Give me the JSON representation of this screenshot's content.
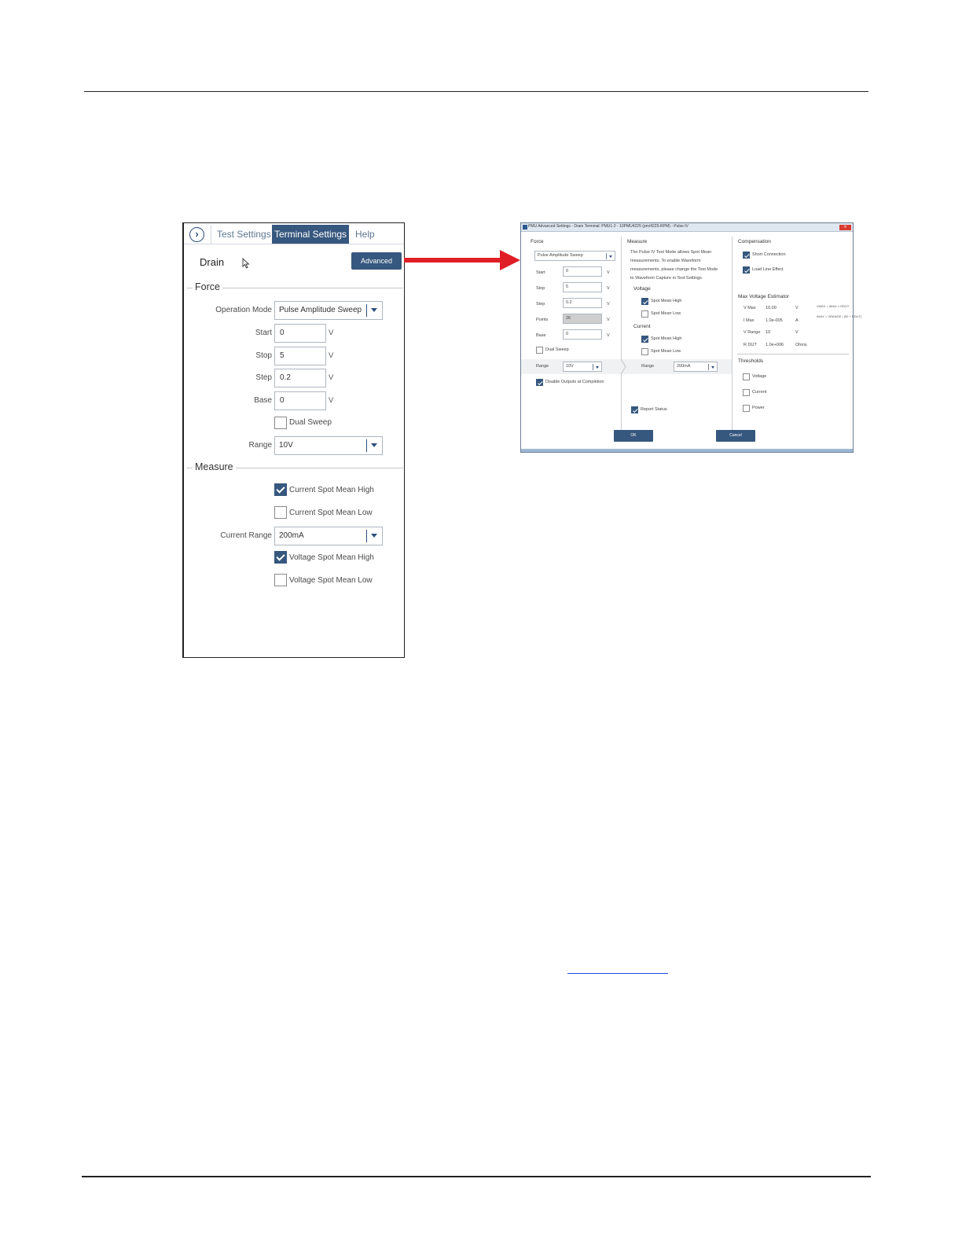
{
  "left_panel": {
    "tabs": [
      "Test Settings",
      "Terminal Settings",
      "Help"
    ],
    "active_tab": "Terminal Settings",
    "terminal_name": "Drain",
    "advanced_button": "Advanced",
    "force": {
      "title": "Force",
      "operation_mode_label": "Operation Mode",
      "operation_mode_value": "Pulse Amplitude Sweep",
      "fields": [
        {
          "label": "Start",
          "value": "0",
          "unit": "V"
        },
        {
          "label": "Stop",
          "value": "5",
          "unit": "V"
        },
        {
          "label": "Step",
          "value": "0.2",
          "unit": "V"
        },
        {
          "label": "Base",
          "value": "0",
          "unit": "V"
        }
      ],
      "dual_sweep_label": "Dual Sweep",
      "dual_sweep_checked": false,
      "range_label": "Range",
      "range_value": "10V"
    },
    "measure": {
      "title": "Measure",
      "current_spot_mean_high": {
        "label": "Current Spot Mean High",
        "checked": true
      },
      "current_spot_mean_low": {
        "label": "Current Spot Mean Low",
        "checked": false
      },
      "current_range_label": "Current Range",
      "current_range_value": "200mA",
      "voltage_spot_mean_high": {
        "label": "Voltage Spot Mean High",
        "checked": true
      },
      "voltage_spot_mean_low": {
        "label": "Voltage Spot Mean Low",
        "checked": false
      }
    }
  },
  "arrow_color": "#e01e26",
  "dialog": {
    "title": "PMU Advanced Settings - Drain Terminal: PMU1-2 - 10PMU4225 (pm/4225-RPM) - Pulse IV",
    "close_label": "✕",
    "force": {
      "title": "Force",
      "mode": "Pulse Amplitude Sweep",
      "fields": [
        {
          "label": "Start",
          "value": "0",
          "unit": "V"
        },
        {
          "label": "Stop",
          "value": "5",
          "unit": "V"
        },
        {
          "label": "Step",
          "value": "0.2",
          "unit": "V"
        },
        {
          "label": "Points",
          "value": "26",
          "unit": "V"
        },
        {
          "label": "Base",
          "value": "0",
          "unit": "V"
        }
      ],
      "dual_sweep_label": "Dual Sweep",
      "range_label": "Range",
      "range_value": "10V",
      "disable_outputs_label": "Disable Outputs at Completion"
    },
    "measure": {
      "title": "Measure",
      "note_lines": [
        "The Pulse IV Test Mode allows Spot Mean",
        "measurements. To enable Waveform",
        "measurements, please change the Test Mode",
        "to Waveform Capture in Test Settings."
      ],
      "voltage_title": "Voltage",
      "voltage_high": "Spot Mean High",
      "voltage_low": "Spot Mean Low",
      "current_title": "Current",
      "current_high": "Spot Mean High",
      "current_low": "Spot Mean Low",
      "range_label": "Range",
      "range_value": "200mA",
      "report_status_label": "Report Status"
    },
    "compensation": {
      "title": "Compensation",
      "short_connection": "Short Connection",
      "load_line_effect": "Load Line Effect"
    },
    "estimator": {
      "title": "Max Voltage Estimator",
      "rows": [
        {
          "label": "V Max",
          "value": "10.00",
          "unit": "V"
        },
        {
          "label": "I Max",
          "value": "1.0e-005",
          "unit": "A"
        },
        {
          "label": "V Range",
          "value": "10",
          "unit": "V"
        },
        {
          "label": "R DUT",
          "value": "1.0e+006",
          "unit": "Ohms"
        }
      ],
      "formula_1": "VMAX = IMAX × RDUT",
      "formula_2": "IMAX = VRANGE / (50 + RDUT)"
    },
    "thresholds": {
      "title": "Thresholds",
      "items": [
        "Voltage",
        "Current",
        "Power"
      ]
    },
    "ok_label": "OK",
    "cancel_label": "Cancel"
  }
}
